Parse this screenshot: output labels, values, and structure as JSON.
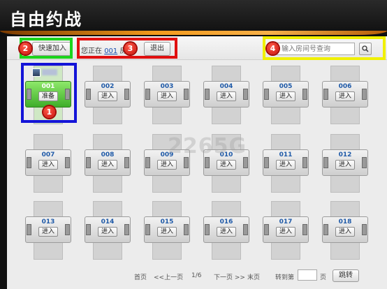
{
  "window": {
    "title": "自由约战"
  },
  "toolbar": {
    "quick_join_label": "快速加入",
    "status_prefix": "您正在",
    "room_number": "001",
    "status_suffix": "房",
    "exit_label": "退出",
    "search_placeholder": "输入房间号查询",
    "search_icon": "magnifier-icon"
  },
  "annotations": {
    "markers": [
      "1",
      "2",
      "3",
      "4"
    ],
    "colors": {
      "green": "#1cd41c",
      "red": "#e01010",
      "yellow": "#f0f000",
      "blue": "#1414d8"
    }
  },
  "tables": [
    {
      "number": "001",
      "action": "准备",
      "active": true
    },
    {
      "number": "002",
      "action": "进入",
      "active": false
    },
    {
      "number": "003",
      "action": "进入",
      "active": false
    },
    {
      "number": "004",
      "action": "进入",
      "active": false
    },
    {
      "number": "005",
      "action": "进入",
      "active": false
    },
    {
      "number": "006",
      "action": "进入",
      "active": false
    },
    {
      "number": "007",
      "action": "进入",
      "active": false
    },
    {
      "number": "008",
      "action": "进入",
      "active": false
    },
    {
      "number": "009",
      "action": "进入",
      "active": false
    },
    {
      "number": "010",
      "action": "进入",
      "active": false
    },
    {
      "number": "011",
      "action": "进入",
      "active": false
    },
    {
      "number": "012",
      "action": "进入",
      "active": false
    },
    {
      "number": "013",
      "action": "进入",
      "active": false
    },
    {
      "number": "014",
      "action": "进入",
      "active": false
    },
    {
      "number": "015",
      "action": "进入",
      "active": false
    },
    {
      "number": "016",
      "action": "进入",
      "active": false
    },
    {
      "number": "017",
      "action": "进入",
      "active": false
    },
    {
      "number": "018",
      "action": "进入",
      "active": false
    }
  ],
  "watermark": "2265G",
  "pager": {
    "first": "首页",
    "prev": "<<上一页",
    "page_indicator": "1/6",
    "next": "下一页 >>",
    "last": "末页",
    "goto_label": "转到第",
    "page_unit": "页",
    "jump_label": "跳转"
  }
}
